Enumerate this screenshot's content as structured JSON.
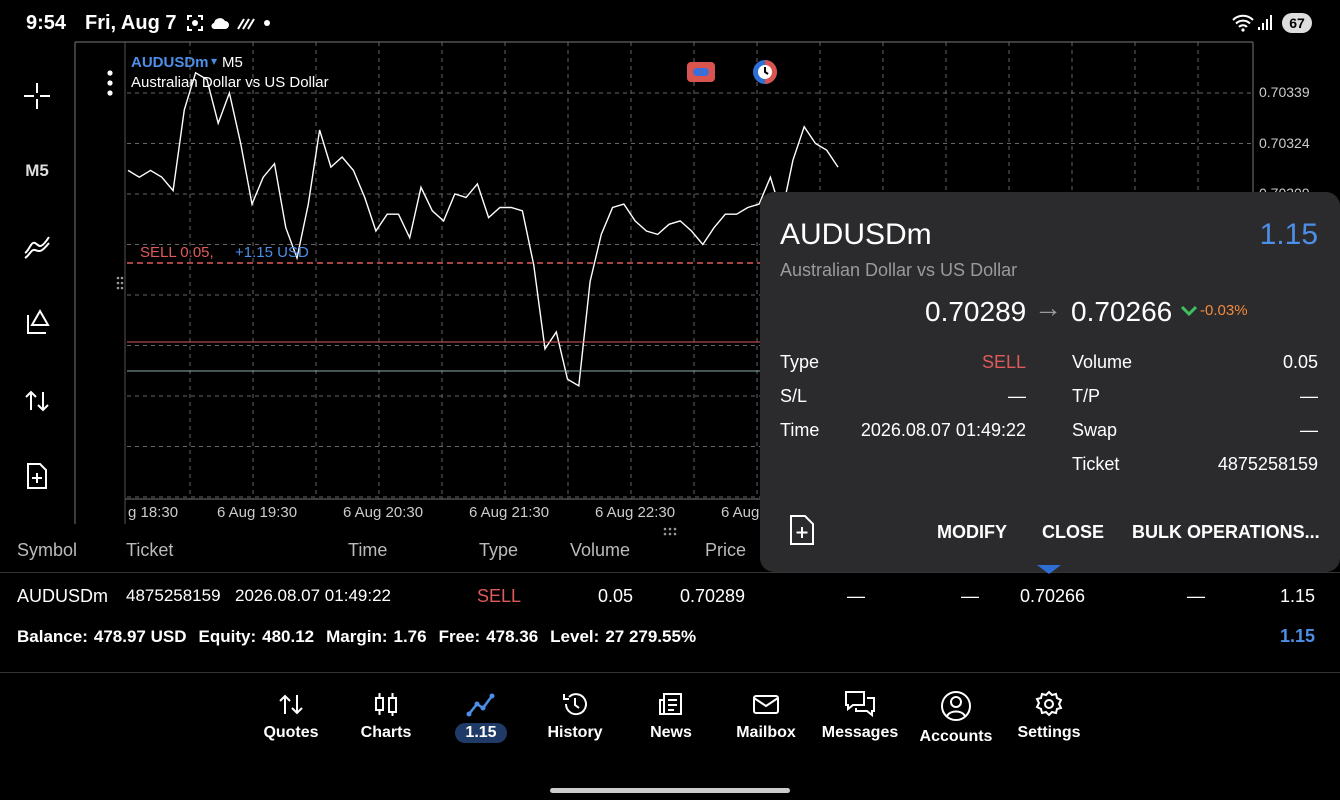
{
  "status": {
    "time": "9:54",
    "date": "Fri, Aug 7",
    "battery": "67"
  },
  "toolbar": {
    "timeframe": "M5",
    "icons": [
      "crosshair-icon",
      "indicators-icon",
      "objects-icon",
      "trade-icon",
      "new-order-icon"
    ]
  },
  "chart": {
    "symbol": "AUDUSDm",
    "timeframe": "M5",
    "description": "Australian Dollar vs US Dollar",
    "position_label": "SELL 0.05,",
    "position_profit": "+1.15 USD",
    "y_ticks": [
      "0.70339",
      "0.70324",
      "0.70309"
    ],
    "x_ticks": [
      "g 18:30",
      "6 Aug 19:30",
      "6 Aug 20:30",
      "6 Aug 21:30",
      "6 Aug 22:30",
      "6 Aug"
    ]
  },
  "chart_data": {
    "type": "line",
    "series": [
      {
        "values": [
          0.70316,
          0.70314,
          0.70316,
          0.70314,
          0.7031,
          0.70334,
          0.70345,
          0.70343,
          0.7033,
          0.70339,
          0.70324,
          0.70306,
          0.70314,
          0.70318,
          0.70299,
          0.7029,
          0.70306,
          0.70328,
          0.70317,
          0.7032,
          0.70316,
          0.70308,
          0.70298,
          0.70303,
          0.70303,
          0.70296,
          0.70311,
          0.70304,
          0.70301,
          0.70309,
          0.70308,
          0.70312,
          0.70302,
          0.70305,
          0.70305,
          0.70304,
          0.70288,
          0.70263,
          0.70268,
          0.70254,
          0.70252,
          0.70283,
          0.70297,
          0.70305,
          0.70306,
          0.70301,
          0.70298,
          0.70297,
          0.703,
          0.70301,
          0.70298,
          0.70294,
          0.70299,
          0.70303,
          0.70303,
          0.70305,
          0.70306,
          0.70314,
          0.70303,
          0.70319,
          0.70329,
          0.70324,
          0.70322,
          0.70317
        ]
      }
    ],
    "y_ticks": [
      "0.70339",
      "0.70324",
      "0.70309"
    ]
  },
  "table": {
    "headers": [
      "Symbol",
      "Ticket",
      "Time",
      "Type",
      "Volume",
      "Price"
    ],
    "row": {
      "symbol": "AUDUSDm",
      "ticket": "4875258159",
      "time": "2026.08.07 01:49:22",
      "type": "SELL",
      "volume": "0.05",
      "price": "0.70289",
      "sl": "—",
      "tp": "—",
      "current": "0.70266",
      "swap": "—",
      "profit": "1.15"
    },
    "summary": {
      "balance_label": "Balance:",
      "balance": "478.97 USD",
      "equity_label": "Equity:",
      "equity": "480.12",
      "margin_label": "Margin:",
      "margin": "1.76",
      "free_label": "Free:",
      "free": "478.36",
      "level_label": "Level:",
      "level": "27 279.55%",
      "profit": "1.15"
    }
  },
  "popup": {
    "symbol": "AUDUSDm",
    "profit": "1.15",
    "description": "Australian Dollar vs US Dollar",
    "open_price": "0.70289",
    "arrow": "→",
    "current_price": "0.70266",
    "change": "-0.03%",
    "type_label": "Type",
    "type": "SELL",
    "sl_label": "S/L",
    "sl": "—",
    "time_label": "Time",
    "time": "2026.08.07 01:49:22",
    "volume_label": "Volume",
    "volume": "0.05",
    "tp_label": "T/P",
    "tp": "—",
    "swap_label": "Swap",
    "swap": "—",
    "ticket_label": "Ticket",
    "ticket": "4875258159",
    "modify": "MODIFY",
    "close": "CLOSE",
    "bulk": "BULK OPERATIONS..."
  },
  "nav": [
    {
      "label": "Quotes",
      "icon": "quotes-icon"
    },
    {
      "label": "Charts",
      "icon": "charts-icon"
    },
    {
      "label": "1.15",
      "icon": "trade-icon"
    },
    {
      "label": "History",
      "icon": "history-icon"
    },
    {
      "label": "News",
      "icon": "news-icon"
    },
    {
      "label": "Mailbox",
      "icon": "mailbox-icon"
    },
    {
      "label": "Messages",
      "icon": "messages-icon"
    },
    {
      "label": "Accounts",
      "icon": "accounts-icon"
    },
    {
      "label": "Settings",
      "icon": "settings-icon"
    }
  ],
  "colors": {
    "accent": "#4d8fe8",
    "sell": "#e05a5a",
    "change": "#f08a3e",
    "popup_bg": "#2b2b2d"
  }
}
